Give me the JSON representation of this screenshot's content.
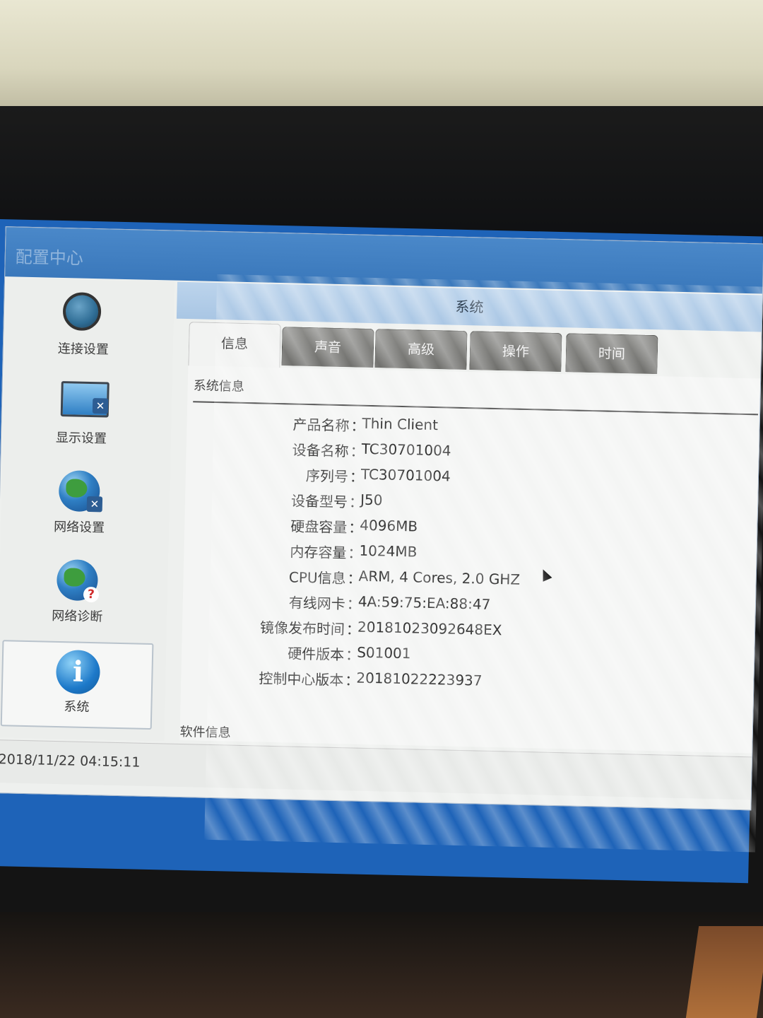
{
  "window": {
    "title": "配置中心"
  },
  "sidebar": {
    "items": [
      {
        "label": "连接设置",
        "icon": "headset-globe-icon"
      },
      {
        "label": "显示设置",
        "icon": "monitor-tool-icon"
      },
      {
        "label": "网络设置",
        "icon": "globe-tool-icon"
      },
      {
        "label": "网络诊断",
        "icon": "globe-question-icon"
      },
      {
        "label": "系统",
        "icon": "info-icon",
        "selected": true
      }
    ]
  },
  "main": {
    "section_title": "系统",
    "tabs": [
      {
        "label": "信息",
        "selected": true
      },
      {
        "label": "声音"
      },
      {
        "label": "高级"
      },
      {
        "label": "操作"
      },
      {
        "label": "时间"
      }
    ],
    "system_info": {
      "heading": "系统信息",
      "fields": [
        {
          "key": "产品名称",
          "value": "Thin Client"
        },
        {
          "key": "设备名称",
          "value": "TC30701004"
        },
        {
          "key": "序列号",
          "value": "TC30701004"
        },
        {
          "key": "设备型号",
          "value": "J50"
        },
        {
          "key": "硬盘容量",
          "value": "4096MB"
        },
        {
          "key": "内存容量",
          "value": "1024MB"
        },
        {
          "key": "CPU信息",
          "value": "ARM, 4 Cores, 2.0 GHZ"
        },
        {
          "key": "有线网卡",
          "value": "4A:59:75:EA:88:47"
        },
        {
          "key": "镜像发布时间",
          "value": "20181023092648EX"
        },
        {
          "key": "硬件版本",
          "value": "S01001"
        },
        {
          "key": "控制中心版本",
          "value": "20181022223937"
        }
      ],
      "separator": "："
    },
    "software_info": {
      "heading": "软件信息"
    }
  },
  "statusbar": {
    "datetime": "2018/11/22 04:15:11"
  },
  "colors": {
    "titlebar": "#3a78bb",
    "section_header": "#a9c6e4",
    "tab_inactive": "#7a7a77",
    "screen_frame": "#1e63b8"
  }
}
